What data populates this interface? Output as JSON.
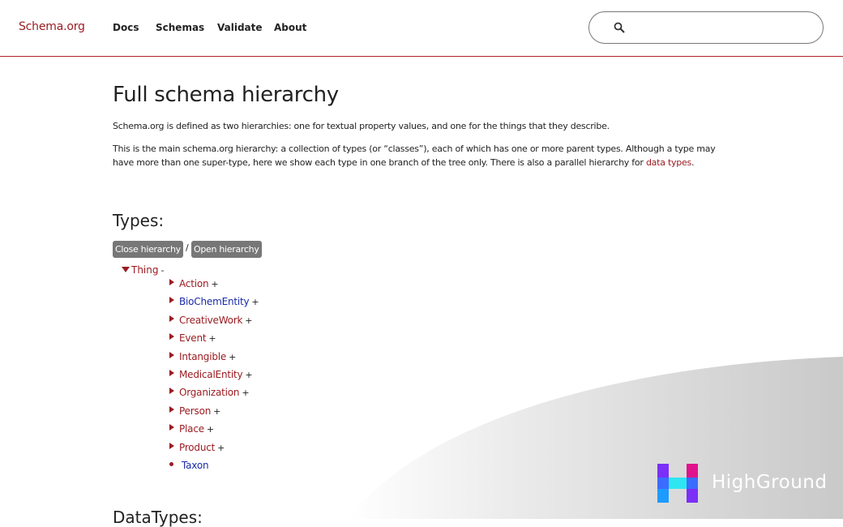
{
  "header": {
    "brand": "Schema.org",
    "nav": [
      "Docs",
      "Schemas",
      "Validate",
      "About"
    ],
    "search": {
      "value": "",
      "placeholder": ""
    }
  },
  "main": {
    "title": "Full schema hierarchy",
    "intro": "Schema.org is defined as two hierarchies: one for textual property values, and one for the things that they describe.",
    "description_text": "This is the main schema.org hierarchy: a collection of types (or “classes”), each of which has one or more parent types. Although a type may have more than one super-type, here we show each type in one branch of the tree only. There is also a parallel hierarchy for ",
    "description_link": "data types",
    "description_end": ".",
    "types_heading": "Types:",
    "close_button": "Close hierarchy",
    "slash": "/",
    "open_button": "Open hierarchy",
    "tree": {
      "root": "Thing",
      "root_sign": "-",
      "children": [
        {
          "label": "Action",
          "sign": "+",
          "color": "#9b1c22"
        },
        {
          "label": "BioChemEntity",
          "sign": "+",
          "color": "#1a2aa8"
        },
        {
          "label": "CreativeWork",
          "sign": "+",
          "color": "#9b1c22"
        },
        {
          "label": "Event",
          "sign": "+",
          "color": "#9b1c22"
        },
        {
          "label": "Intangible",
          "sign": "+",
          "color": "#9b1c22"
        },
        {
          "label": "MedicalEntity",
          "sign": "+",
          "color": "#9b1c22"
        },
        {
          "label": "Organization",
          "sign": "+",
          "color": "#9b1c22"
        },
        {
          "label": "Person",
          "sign": "+",
          "color": "#9b1c22"
        },
        {
          "label": "Place",
          "sign": "+",
          "color": "#9b1c22"
        },
        {
          "label": "Product",
          "sign": "+",
          "color": "#9b1c22"
        },
        {
          "label": "Taxon",
          "sign": "",
          "color": "#1a2aa8"
        }
      ]
    },
    "datatypes_heading": "DataTypes:"
  },
  "watermark": {
    "text": "HighGround"
  },
  "colors": {
    "accent": "#9b1c22",
    "link_blue": "#1a2aa8",
    "button_gray": "#777777"
  }
}
